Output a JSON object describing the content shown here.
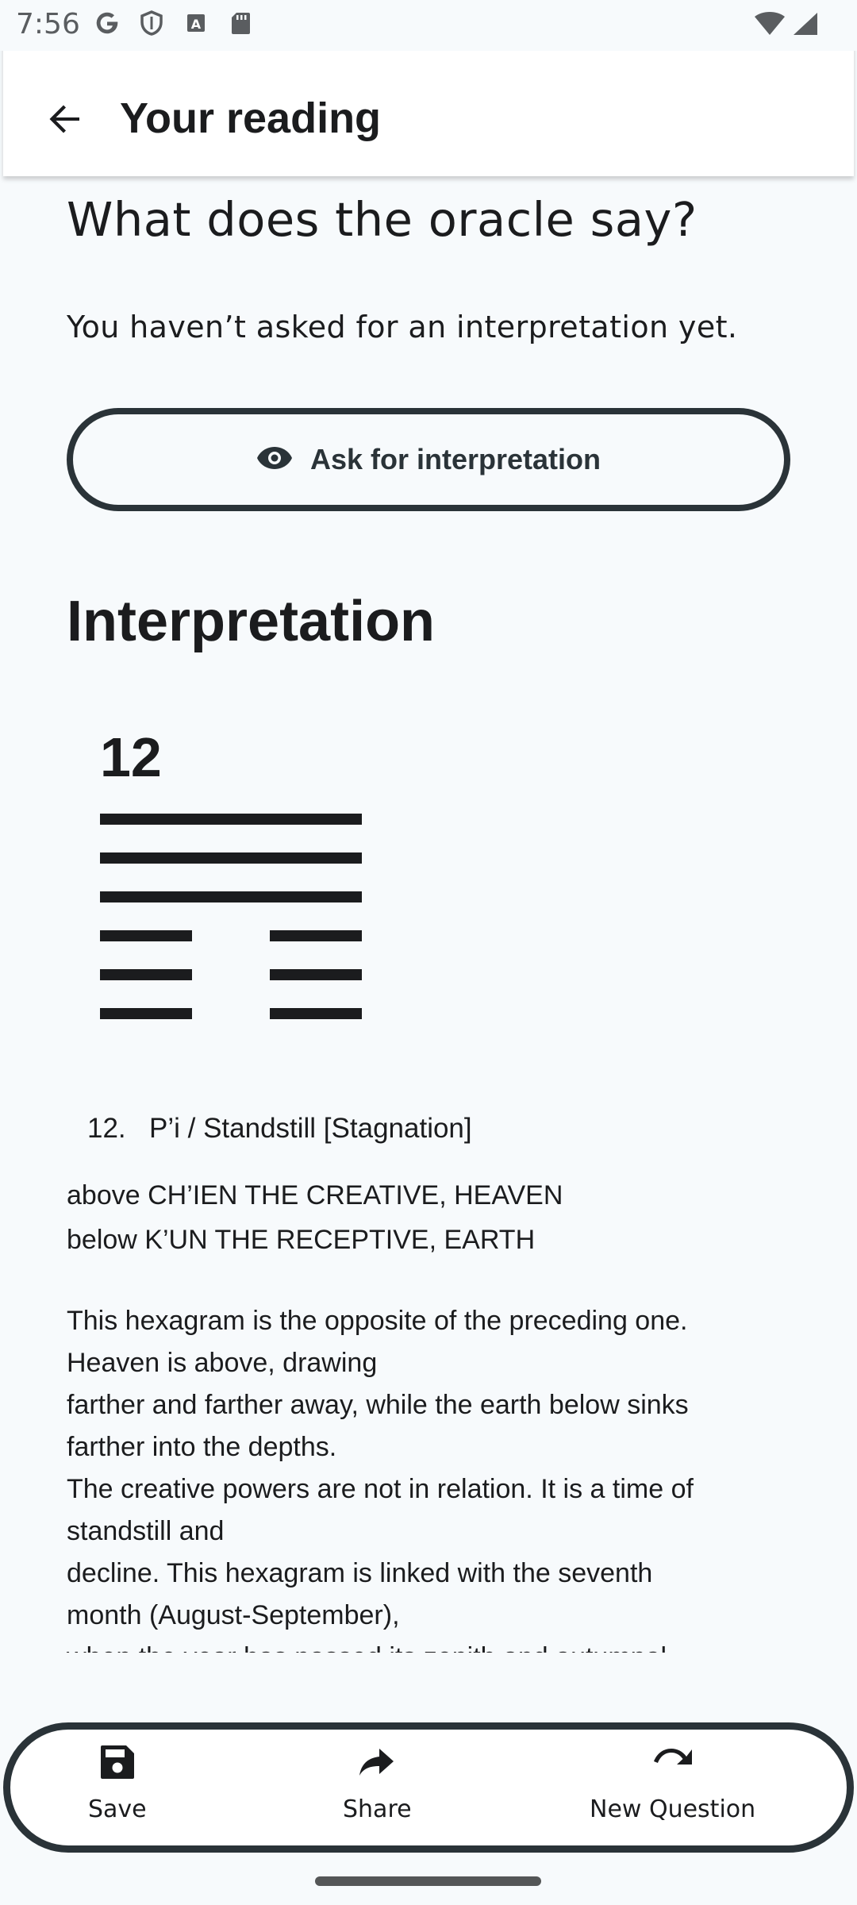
{
  "status_bar": {
    "time": "7:56",
    "left_icons": [
      "google-icon",
      "shield-icon",
      "font-icon",
      "sd-card-icon"
    ],
    "right_icons": [
      "wifi-icon",
      "signal-icon"
    ]
  },
  "app_bar": {
    "title": "Your reading",
    "back_icon": "arrow-back-icon"
  },
  "oracle": {
    "heading": "What does the oracle say?",
    "subtitle": "You haven’t asked for an interpretation yet.",
    "ask_button_label": "Ask for interpretation",
    "ask_button_icon": "eye-icon"
  },
  "interpretation": {
    "heading": "Interpretation",
    "hexagram_number": "12",
    "hexagram_lines_top_to_bottom": [
      "solid",
      "solid",
      "solid",
      "broken",
      "broken",
      "broken"
    ],
    "title_number": "12.",
    "title_text": "P’i / Standstill [Stagnation]",
    "above": "above CH’IEN THE CREATIVE, HEAVEN",
    "below": "below K’UN THE RECEPTIVE, EARTH",
    "body_lines": [
      "This hexagram is the opposite of the preceding one.",
      "Heaven is above, drawing",
      "farther and farther away, while the earth below sinks",
      "farther into the depths.",
      "The creative powers are not in relation. It is a time of",
      "standstill and",
      "decline. This hexagram is linked with the seventh",
      "month (August-September),",
      "when the year has passed its zenith and autumnal"
    ]
  },
  "bottom_nav": {
    "items": [
      {
        "label": "Save",
        "icon": "save-icon"
      },
      {
        "label": "Share",
        "icon": "share-icon"
      },
      {
        "label": "New Question",
        "icon": "redo-icon"
      }
    ]
  },
  "colors": {
    "background": "#f7fafc",
    "text": "#1b1c1e",
    "outline": "#2a3338"
  }
}
